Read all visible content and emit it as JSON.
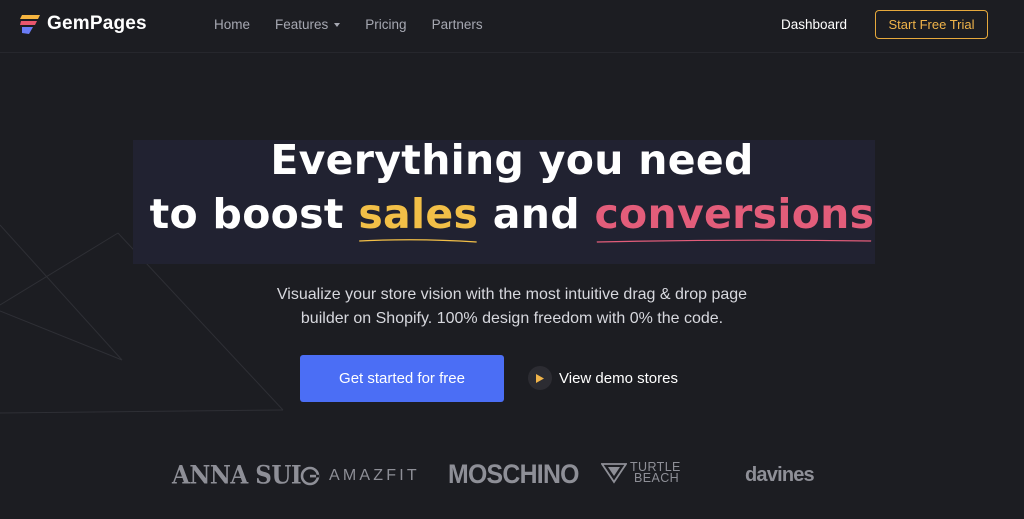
{
  "nav": {
    "brand": "GemPages",
    "links": [
      "Home",
      "Features",
      "Pricing",
      "Partners"
    ],
    "dashboard": "Dashboard",
    "trial": "Start Free Trial"
  },
  "hero": {
    "line1": "Everything you need",
    "line2_a": "to boost",
    "line2_sales": "sales",
    "line2_b": "and",
    "line2_conv": "conversions",
    "sub1": "Visualize your store vision with the most intuitive drag & drop page",
    "sub2": "builder on Shopify. 100% design freedom with 0% the code.",
    "cta": "Get started for free",
    "demo": "View demo stores"
  },
  "brands": {
    "anna": "ANNA SUI",
    "amazfit": "AMAZFIT",
    "moschino": "MOSCHINO",
    "turtle1": "TURTLE",
    "turtle2": "BEACH",
    "davines": "davines"
  },
  "colors": {
    "accent_yellow": "#f2bf47",
    "accent_pink": "#e35d7a",
    "cta_blue": "#4b6ef5",
    "trial_border": "#e6a93c",
    "background": "#1c1d22"
  },
  "icons": {
    "logo": "gempages-logo-icon",
    "features_caret": "caret-down-icon",
    "play": "play-icon"
  }
}
